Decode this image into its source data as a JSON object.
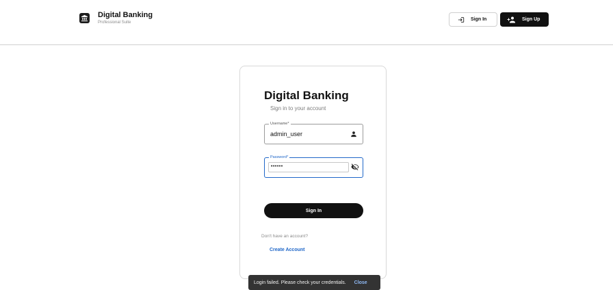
{
  "header": {
    "brand_title": "Digital Banking",
    "brand_subtitle": "Professional Suite",
    "brand_icon": "bank-icon",
    "signin_label": "Sign In",
    "signin_icon": "login-icon",
    "signup_label": "Sign Up",
    "signup_icon": "person-add-icon"
  },
  "card": {
    "title": "Digital Banking",
    "subtitle": "Sign in to your account",
    "username": {
      "label": "Username*",
      "value": "admin_user",
      "icon": "person-icon"
    },
    "password": {
      "label": "Password*",
      "value": "••••••",
      "icon": "visibility-off-icon"
    },
    "submit_label": "Sign In",
    "no_account_text": "Don't have an account?",
    "create_account_label": "Create Account"
  },
  "toast": {
    "message": "Login failed. Please check your credentials.",
    "close_label": "Close"
  },
  "colors": {
    "primary": "#111111",
    "focus": "#1e66c8",
    "link": "#1e66c8",
    "toast_bg": "#333333"
  }
}
